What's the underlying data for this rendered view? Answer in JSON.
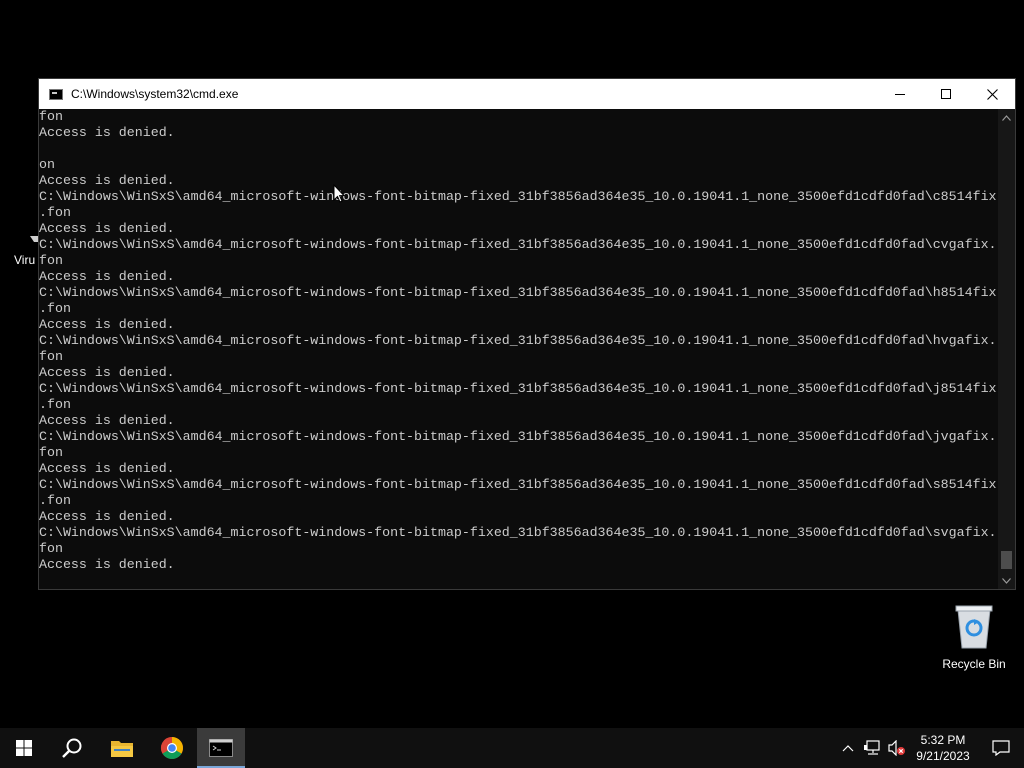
{
  "desktop": {
    "icons": [
      {
        "label": "Viru"
      },
      {
        "label": "Recycle Bin"
      }
    ]
  },
  "window": {
    "title": "C:\\Windows\\system32\\cmd.exe",
    "console_lines": [
      "fon",
      "Access is denied.",
      "",
      "on",
      "Access is denied.",
      "C:\\Windows\\WinSxS\\amd64_microsoft-windows-font-bitmap-fixed_31bf3856ad364e35_10.0.19041.1_none_3500efd1cdfd0fad\\c8514fix",
      ".fon",
      "Access is denied.",
      "C:\\Windows\\WinSxS\\amd64_microsoft-windows-font-bitmap-fixed_31bf3856ad364e35_10.0.19041.1_none_3500efd1cdfd0fad\\cvgafix.",
      "fon",
      "Access is denied.",
      "C:\\Windows\\WinSxS\\amd64_microsoft-windows-font-bitmap-fixed_31bf3856ad364e35_10.0.19041.1_none_3500efd1cdfd0fad\\h8514fix",
      ".fon",
      "Access is denied.",
      "C:\\Windows\\WinSxS\\amd64_microsoft-windows-font-bitmap-fixed_31bf3856ad364e35_10.0.19041.1_none_3500efd1cdfd0fad\\hvgafix.",
      "fon",
      "Access is denied.",
      "C:\\Windows\\WinSxS\\amd64_microsoft-windows-font-bitmap-fixed_31bf3856ad364e35_10.0.19041.1_none_3500efd1cdfd0fad\\j8514fix",
      ".fon",
      "Access is denied.",
      "C:\\Windows\\WinSxS\\amd64_microsoft-windows-font-bitmap-fixed_31bf3856ad364e35_10.0.19041.1_none_3500efd1cdfd0fad\\jvgafix.",
      "fon",
      "Access is denied.",
      "C:\\Windows\\WinSxS\\amd64_microsoft-windows-font-bitmap-fixed_31bf3856ad364e35_10.0.19041.1_none_3500efd1cdfd0fad\\s8514fix",
      ".fon",
      "Access is denied.",
      "C:\\Windows\\WinSxS\\amd64_microsoft-windows-font-bitmap-fixed_31bf3856ad364e35_10.0.19041.1_none_3500efd1cdfd0fad\\svgafix.",
      "fon",
      "Access is denied."
    ]
  },
  "taskbar": {
    "apps": [
      "start-icon",
      "search-icon",
      "file-explorer-icon",
      "chrome-icon",
      "cmd-icon"
    ],
    "clock": {
      "time": "5:32 PM",
      "date": "9/21/2023"
    }
  },
  "colors": {
    "console_bg": "#0c0c0c",
    "console_text": "#cccccc",
    "taskbar_bg": "#101010",
    "start_blue": "#ffffff"
  }
}
